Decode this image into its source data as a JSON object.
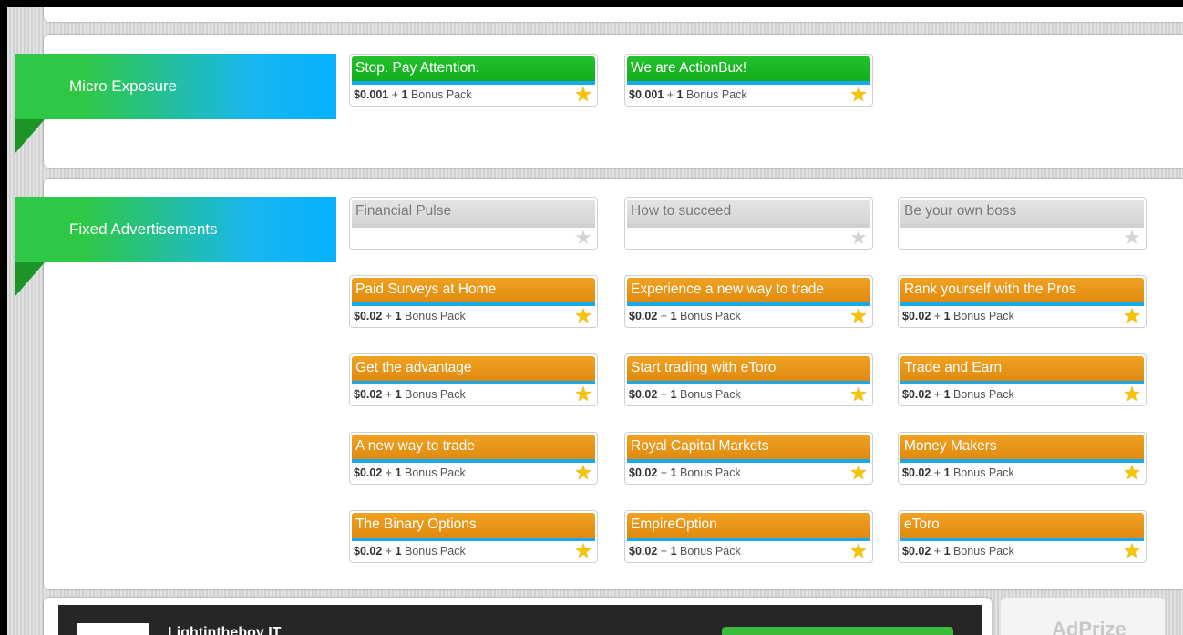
{
  "sections": {
    "micro": {
      "title": "Micro Exposure"
    },
    "fixed": {
      "title": "Fixed Advertisements"
    }
  },
  "micro_ads": [
    {
      "title": "Stop. Pay Attention.",
      "price": "$0.001",
      "plus": "+",
      "count": "1",
      "bonus": "Bonus Pack"
    },
    {
      "title": "We are ActionBux!",
      "price": "$0.001",
      "plus": "+",
      "count": "1",
      "bonus": "Bonus Pack"
    }
  ],
  "fixed_ads": [
    {
      "title": "Financial Pulse",
      "style": "grey"
    },
    {
      "title": "How to succeed",
      "style": "grey"
    },
    {
      "title": "Be your own boss",
      "style": "grey"
    },
    {
      "title": "Paid Surveys at Home",
      "price": "$0.02",
      "plus": "+",
      "count": "1",
      "bonus": "Bonus Pack"
    },
    {
      "title": "Experience a new way to trade",
      "price": "$0.02",
      "plus": "+",
      "count": "1",
      "bonus": "Bonus Pack"
    },
    {
      "title": "Rank yourself with the Pros",
      "price": "$0.02",
      "plus": "+",
      "count": "1",
      "bonus": "Bonus Pack"
    },
    {
      "title": "Get the advantage",
      "price": "$0.02",
      "plus": "+",
      "count": "1",
      "bonus": "Bonus Pack"
    },
    {
      "title": "Start trading with eToro",
      "price": "$0.02",
      "plus": "+",
      "count": "1",
      "bonus": "Bonus Pack"
    },
    {
      "title": "Trade and Earn",
      "price": "$0.02",
      "plus": "+",
      "count": "1",
      "bonus": "Bonus Pack"
    },
    {
      "title": "A new way to trade",
      "price": "$0.02",
      "plus": "+",
      "count": "1",
      "bonus": "Bonus Pack"
    },
    {
      "title": "Royal Capital Markets",
      "price": "$0.02",
      "plus": "+",
      "count": "1",
      "bonus": "Bonus Pack"
    },
    {
      "title": "Money Makers",
      "price": "$0.02",
      "plus": "+",
      "count": "1",
      "bonus": "Bonus Pack"
    },
    {
      "title": "The Binary Options",
      "price": "$0.02",
      "plus": "+",
      "count": "1",
      "bonus": "Bonus Pack"
    },
    {
      "title": "EmpireOption",
      "price": "$0.02",
      "plus": "+",
      "count": "1",
      "bonus": "Bonus Pack"
    },
    {
      "title": "eToro",
      "price": "$0.02",
      "plus": "+",
      "count": "1",
      "bonus": "Bonus Pack"
    }
  ],
  "footer": {
    "banner_title": "Lightintheboy IT",
    "adprize": "AdPrize"
  },
  "icons": {
    "star_active": "star-gold-icon",
    "star_inactive": "star-grey-icon"
  },
  "colors": {
    "green": "#18b020",
    "orange": "#e8941a",
    "blue": "#18a9ec",
    "ribbon_green": "#2fc846",
    "ribbon_blue": "#05b2fb"
  }
}
